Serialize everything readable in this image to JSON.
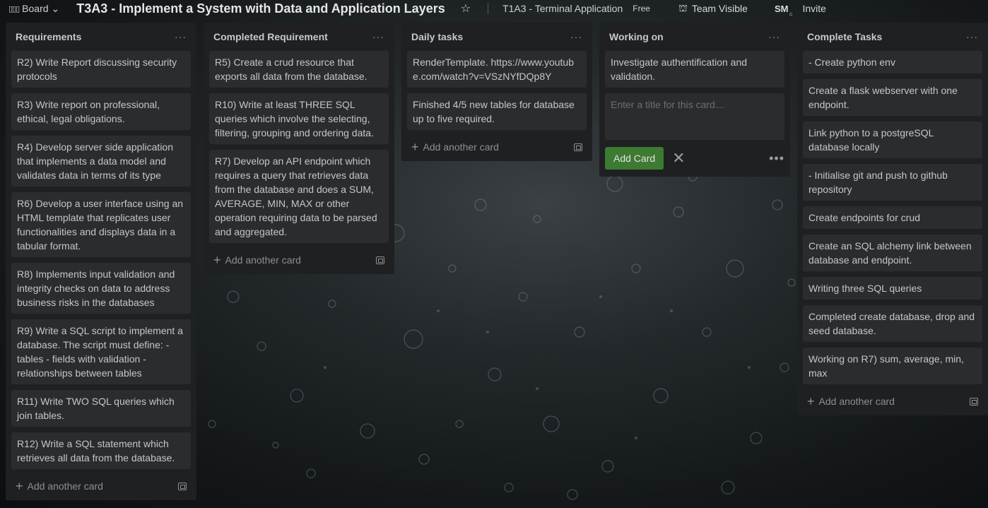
{
  "header": {
    "board_button": "Board",
    "board_title": "T3A3 - Implement a System with Data and Application Layers",
    "workspace": "T1A3 - Terminal Application",
    "plan": "Free",
    "visibility": "Team Visible",
    "avatar_initials": "SM",
    "invite": "Invite"
  },
  "lists": [
    {
      "title": "Requirements",
      "cards": [
        "R2) Write Report discussing security protocols",
        "R3) Write report on professional, ethical, legal obligations.",
        "R4) Develop server side application that implements a data model and validates data in terms of its type",
        "R6) Develop a user interface using an HTML template that replicates user functionalities and displays data in a tabular format.",
        "R8) Implements input validation and integrity checks on data to address business risks in the databases",
        "R9) Write a SQL script to implement a database. The script must define: - tables - fields with validation - relationships between tables",
        "R11) Write TWO SQL queries which join tables.",
        "R12) Write a SQL statement which retrieves all data from the database."
      ],
      "add_label": "Add another card"
    },
    {
      "title": "Completed Requirement",
      "cards": [
        "R5) Create a crud resource that exports all data from the database.",
        "R10) Write at least THREE SQL queries which involve the selecting, filtering, grouping and ordering data.",
        "R7) Develop an API endpoint which requires a query that retrieves data from the database and does a SUM, AVERAGE, MIN, MAX or other operation requiring data to be parsed and aggregated."
      ],
      "add_label": "Add another card"
    },
    {
      "title": "Daily tasks",
      "cards": [
        "RenderTemplate. https://www.youtube.com/watch?v=VSzNYfDQp8Y",
        "Finished 4/5 new tables for database up to five required."
      ],
      "add_label": "Add another card"
    },
    {
      "title": "Working on",
      "cards": [
        "Investigate authentification and validation."
      ],
      "composer_placeholder": "Enter a title for this card…",
      "add_button": "Add Card"
    },
    {
      "title": "Complete Tasks",
      "cards": [
        "- Create python env",
        "Create a flask webserver with one endpoint.",
        "Link python to a postgreSQL database locally",
        "- Initialise git and push to github repository",
        "Create endpoints for crud",
        "Create an SQL alchemy link between database and endpoint.",
        "Writing three SQL queries",
        "Completed create database, drop and seed database.",
        "Working on R7) sum, average, min, max"
      ],
      "add_label": "Add another card"
    }
  ]
}
